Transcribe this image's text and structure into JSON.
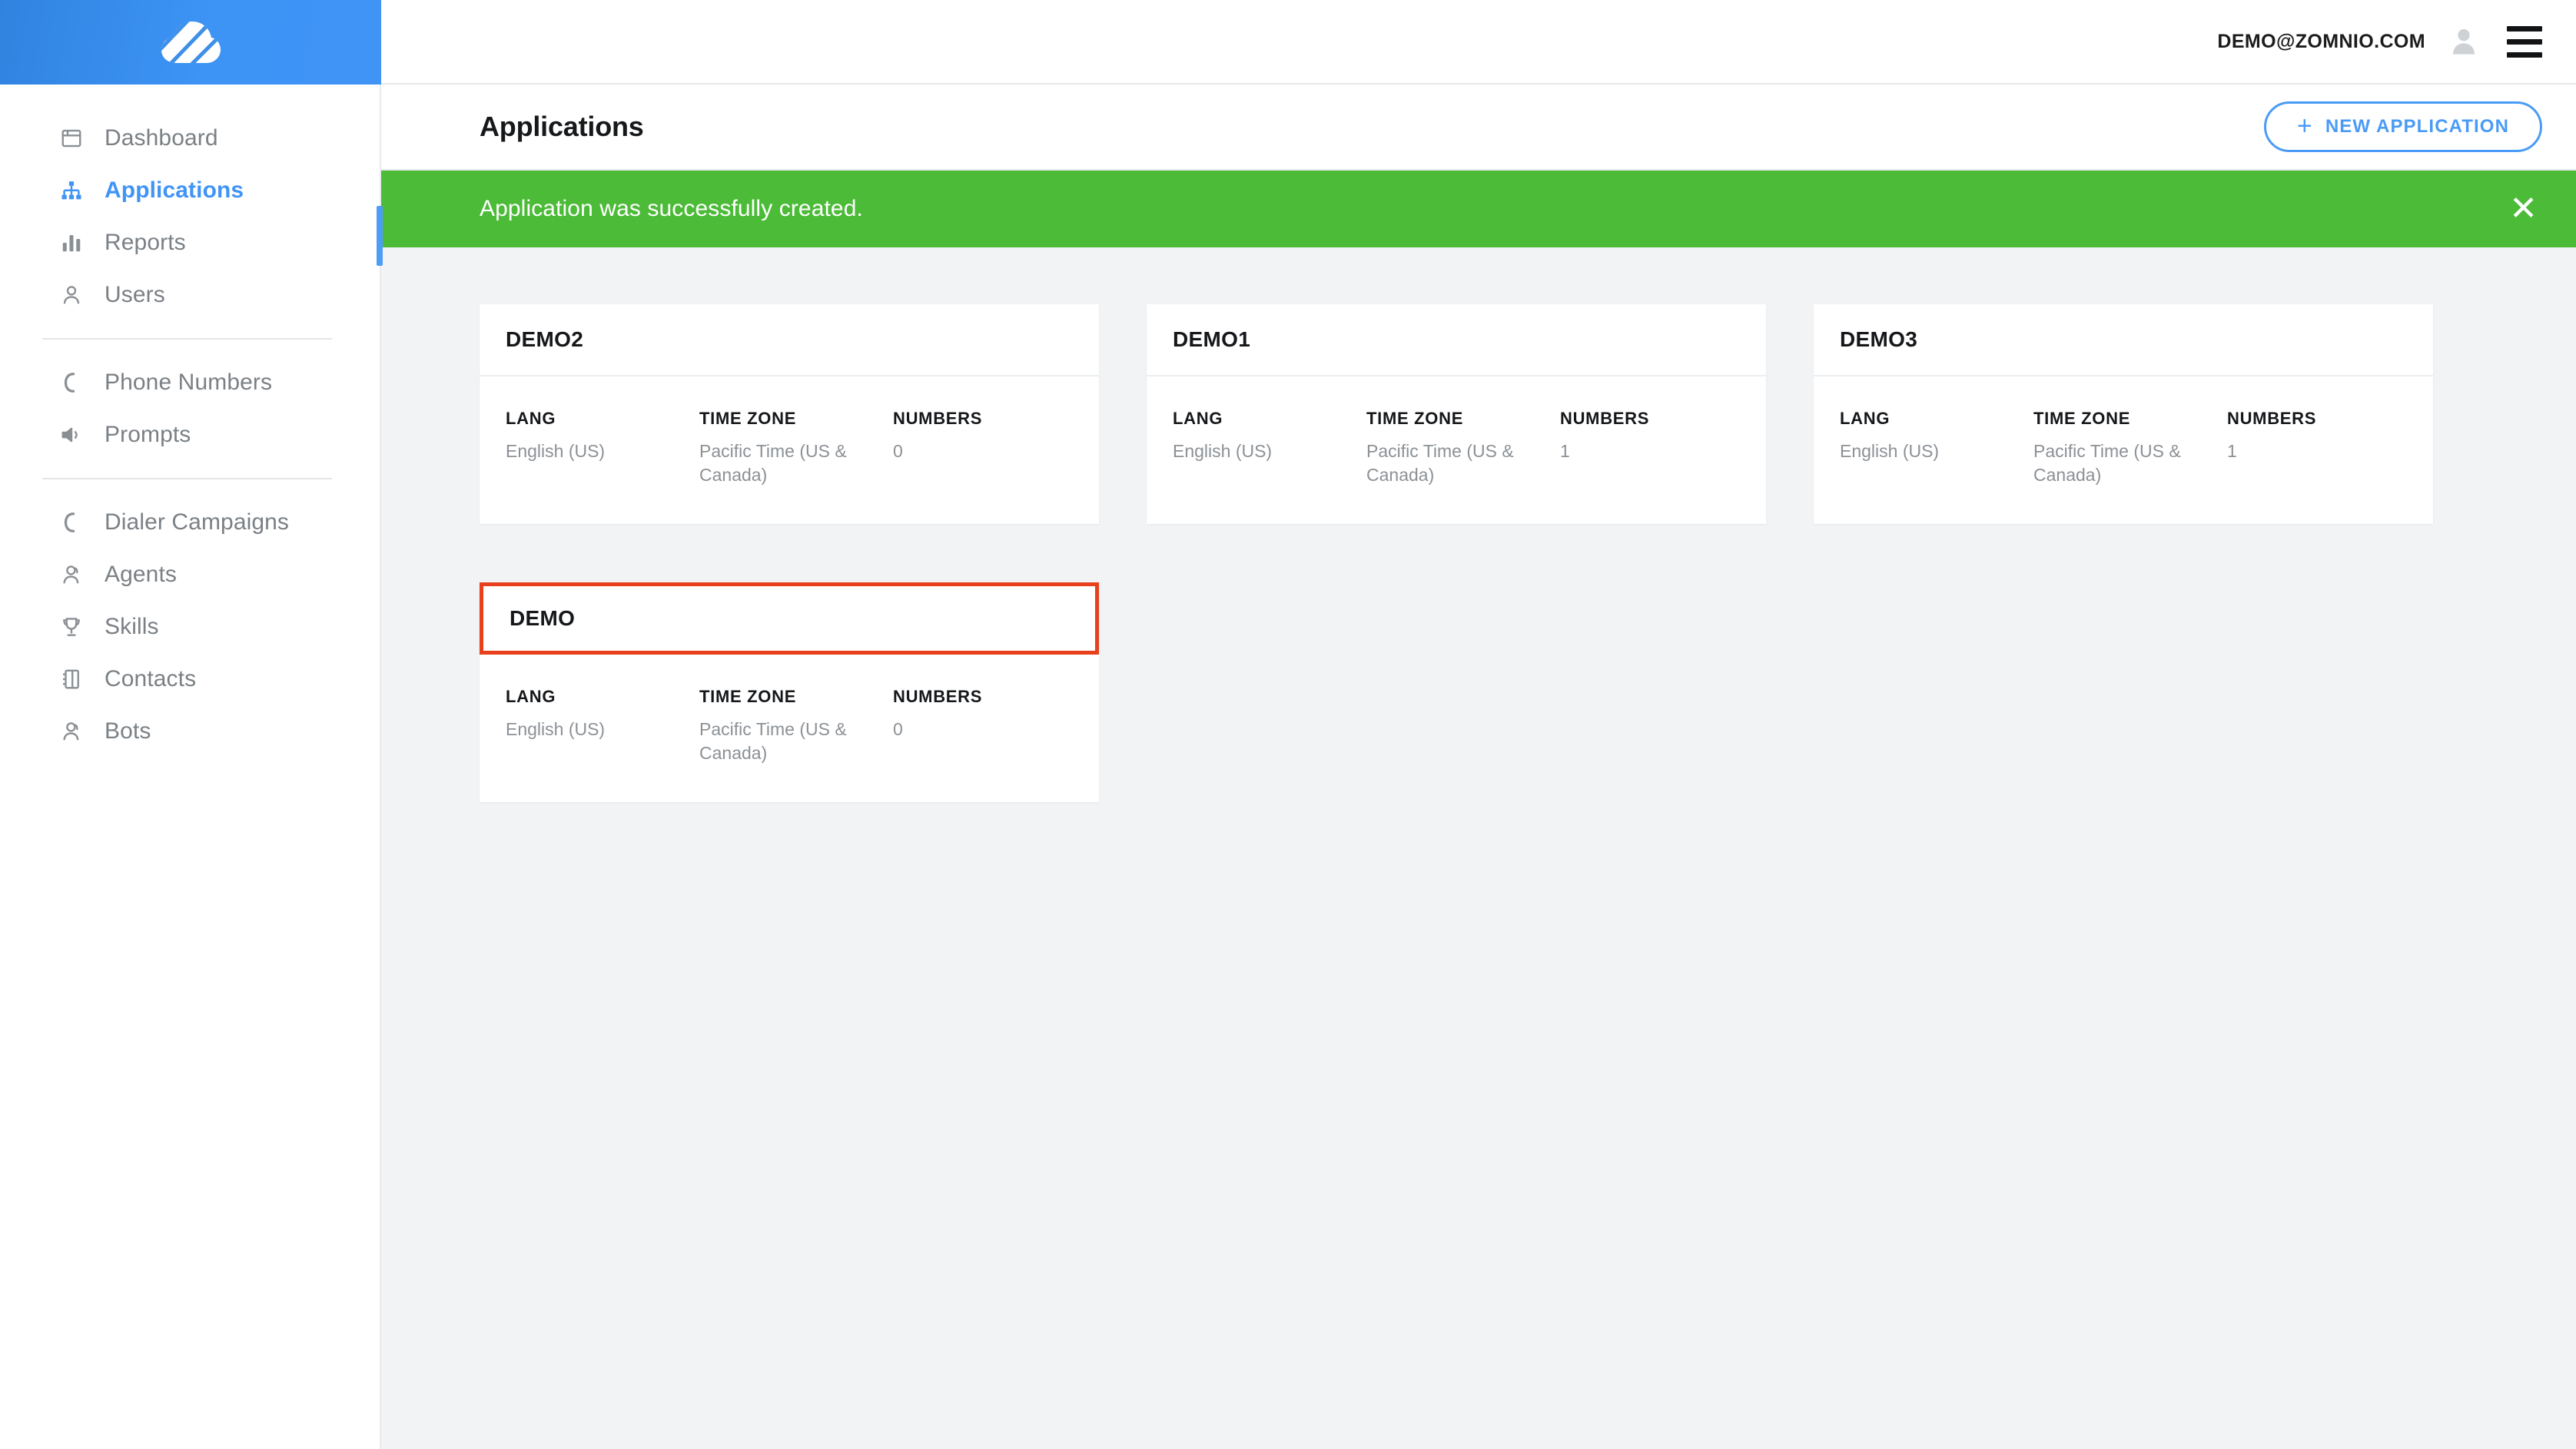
{
  "brand": {
    "logo_icon": "cloud-logo-icon",
    "accent_color": "#4094f6",
    "header_gradient_from": "#3183e0",
    "header_gradient_to": "#4094f6"
  },
  "topbar": {
    "user_email": "DEMO@ZOMNIO.COM",
    "avatar_icon": "user-avatar-icon",
    "menu_icon": "hamburger-menu-icon"
  },
  "sidebar": {
    "groups": [
      {
        "items": [
          {
            "label": "Dashboard",
            "icon": "dashboard-window-icon",
            "active": false
          },
          {
            "label": "Applications",
            "icon": "sitemap-icon",
            "active": true
          },
          {
            "label": "Reports",
            "icon": "bar-chart-icon",
            "active": false
          },
          {
            "label": "Users",
            "icon": "user-icon",
            "active": false
          }
        ]
      },
      {
        "items": [
          {
            "label": "Phone Numbers",
            "icon": "phone-icon",
            "active": false
          },
          {
            "label": "Prompts",
            "icon": "speaker-icon",
            "active": false
          }
        ]
      },
      {
        "items": [
          {
            "label": "Dialer Campaigns",
            "icon": "phone-icon",
            "active": false
          },
          {
            "label": "Agents",
            "icon": "headset-user-icon",
            "active": false
          },
          {
            "label": "Skills",
            "icon": "trophy-icon",
            "active": false
          },
          {
            "label": "Contacts",
            "icon": "address-book-icon",
            "active": false
          },
          {
            "label": "Bots",
            "icon": "headset-user-icon",
            "active": false
          }
        ]
      }
    ]
  },
  "page": {
    "title": "Applications",
    "new_button_label": "NEW APPLICATION",
    "new_button_icon": "plus-icon"
  },
  "alert": {
    "message": "Application was successfully created.",
    "close_icon": "close-icon",
    "background_color": "#4cbb38",
    "text_color": "#ffffff"
  },
  "cards": {
    "labels": {
      "lang": "LANG",
      "time_zone": "TIME ZONE",
      "numbers": "NUMBERS"
    },
    "highlight_color": "#e8401c",
    "items": [
      {
        "name": "DEMO2",
        "lang": "English (US)",
        "time_zone": "Pacific Time (US & Canada)",
        "numbers": "0",
        "highlighted": false
      },
      {
        "name": "DEMO1",
        "lang": "English (US)",
        "time_zone": "Pacific Time (US & Canada)",
        "numbers": "1",
        "highlighted": false
      },
      {
        "name": "DEMO3",
        "lang": "English (US)",
        "time_zone": "Pacific Time (US & Canada)",
        "numbers": "1",
        "highlighted": false
      },
      {
        "name": "DEMO",
        "lang": "English (US)",
        "time_zone": "Pacific Time (US & Canada)",
        "numbers": "0",
        "highlighted": true
      }
    ]
  }
}
